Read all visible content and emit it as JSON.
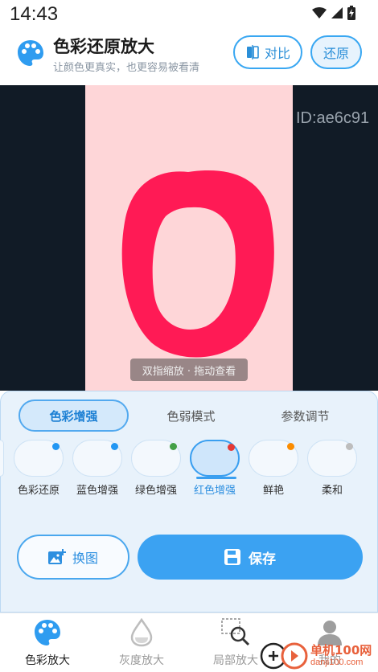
{
  "status_bar": {
    "time": "14:43"
  },
  "header": {
    "title": "色彩还原放大",
    "subtitle": "让颜色更真实，也更容易被看清",
    "compare_label": "对比",
    "restore_label": "还原"
  },
  "preview": {
    "id_text": "ID:ae6c91",
    "hint": "双指缩放 · 拖动查看"
  },
  "tabs": [
    {
      "label": "色彩增强",
      "active": true
    },
    {
      "label": "色弱模式",
      "active": false
    },
    {
      "label": "参数调节",
      "active": false
    }
  ],
  "modes": [
    {
      "label": "色彩还原",
      "dot_color": "#2196f3",
      "active": false
    },
    {
      "label": "蓝色增强",
      "dot_color": "#2196f3",
      "active": false
    },
    {
      "label": "绿色增强",
      "dot_color": "#43a047",
      "active": false
    },
    {
      "label": "红色增强",
      "dot_color": "#e53935",
      "active": true
    },
    {
      "label": "鲜艳",
      "dot_color": "#fb8c00",
      "active": false
    },
    {
      "label": "柔和",
      "dot_color": "#bdbdbd",
      "active": false
    }
  ],
  "actions": {
    "swap_label": "换图",
    "save_label": "保存"
  },
  "nav": [
    {
      "label": "色彩放大",
      "icon": "palette-icon",
      "active": true
    },
    {
      "label": "灰度放大",
      "icon": "droplet-icon",
      "active": false
    },
    {
      "label": "局部放大",
      "icon": "magnifier-icon",
      "active": false
    },
    {
      "label": "我的",
      "icon": "person-icon",
      "active": false
    }
  ],
  "watermark": {
    "site": "单机100网",
    "url": "danji100.com"
  },
  "colors": {
    "accent": "#3ba2f2",
    "preview_bg": "#111b26",
    "image_bg": "#fed6d8",
    "ring": "#ff1a55"
  }
}
